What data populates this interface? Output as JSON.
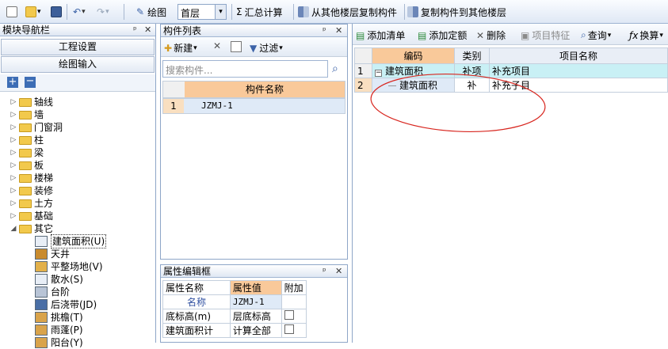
{
  "toolbar": {
    "draw_label": "绘图",
    "floor_value": "首层",
    "sum_label": "汇总计算",
    "copy_from_label": "从其他楼层复制构件",
    "copy_to_label": "复制构件到其他楼层"
  },
  "left_panel": {
    "title": "模块导航栏",
    "project_settings": "工程设置",
    "drawing_input": "绘图输入",
    "tree": [
      {
        "label": "轴线"
      },
      {
        "label": "墙"
      },
      {
        "label": "门窗洞"
      },
      {
        "label": "柱"
      },
      {
        "label": "梁"
      },
      {
        "label": "板"
      },
      {
        "label": "楼梯"
      },
      {
        "label": "装修"
      },
      {
        "label": "土方"
      },
      {
        "label": "基础"
      },
      {
        "label": "其它"
      }
    ],
    "children": [
      {
        "label": "建筑面积(U)"
      },
      {
        "label": "天井"
      },
      {
        "label": "平整场地(V)"
      },
      {
        "label": "散水(S)"
      },
      {
        "label": "台阶"
      },
      {
        "label": "后浇带(JD)"
      },
      {
        "label": "挑檐(T)"
      },
      {
        "label": "雨蓬(P)"
      },
      {
        "label": "阳台(Y)"
      }
    ]
  },
  "component_list": {
    "title": "构件列表",
    "new_label": "新建",
    "filter_label": "过滤",
    "search_placeholder": "搜索构件...",
    "column_header": "构件名称",
    "rows": [
      {
        "index": "1",
        "name": "JZMJ-1"
      }
    ]
  },
  "property_editor": {
    "title": "属性编辑框",
    "headers": [
      "属性名称",
      "属性值",
      "附加"
    ],
    "rows": [
      {
        "name": "名称",
        "value": "JZMJ-1"
      },
      {
        "name": "底标高(m)",
        "value": "层底标高"
      },
      {
        "name": "建筑面积计",
        "value": "计算全部"
      }
    ]
  },
  "right_panel": {
    "toolbar": {
      "add_list": "添加清单",
      "add_quota": "添加定额",
      "delete": "删除",
      "item_feature": "项目特征",
      "query": "查询",
      "convert": "换算"
    },
    "headers": [
      "编码",
      "类别",
      "项目名称"
    ],
    "rows": [
      {
        "index": "1",
        "code": "建筑面积",
        "type": "补项",
        "name": "补充项目"
      },
      {
        "index": "2",
        "code": "建筑面积",
        "type": "补",
        "name": "补充子目"
      }
    ]
  },
  "colors": {
    "accent": "#2e5f9e",
    "highlight_header": "#f9c99a",
    "selected_row": "#c9f0f5",
    "annotation_circle": "#d8261f"
  }
}
